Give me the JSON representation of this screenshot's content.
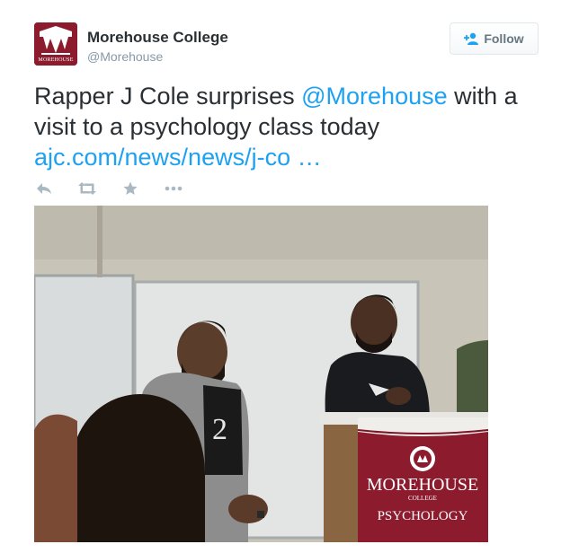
{
  "user": {
    "name": "Morehouse College",
    "handle": "@Morehouse",
    "avatar_wordmark": "MOREHOUSE"
  },
  "follow_button": {
    "label": "Follow",
    "icon": "add-user-icon"
  },
  "tweet": {
    "text_1": "Rapper J Cole surprises ",
    "mention": "@Morehouse",
    "text_2": " with a visit to a psychology class today ",
    "link": "ajc.com/news/news/j-co …"
  },
  "actions": [
    {
      "name": "reply",
      "icon": "reply-icon"
    },
    {
      "name": "retweet",
      "icon": "retweet-icon"
    },
    {
      "name": "favorite",
      "icon": "star-icon"
    },
    {
      "name": "more",
      "icon": "more-icon"
    }
  ],
  "photo": {
    "podium_logo_text": "MOREHOUSE",
    "podium_logo_sub": "COLLEGE",
    "podium_banner": "PSYCHOLOGY"
  },
  "colors": {
    "link": "#1da1f2",
    "text": "#292f33",
    "muted": "#8899a6",
    "brand_maroon": "#8c1b2e"
  }
}
